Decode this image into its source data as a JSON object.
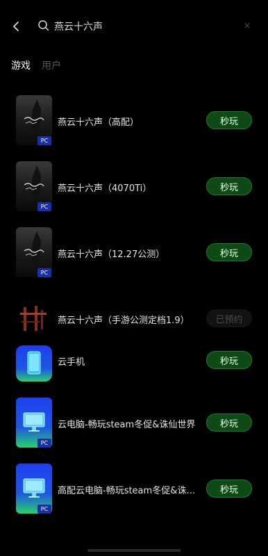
{
  "search": {
    "query": "燕云十六声",
    "clear_symbol": "×"
  },
  "tabs": [
    {
      "label": "游戏",
      "active": true
    },
    {
      "label": "用户",
      "active": false
    }
  ],
  "results": [
    {
      "title": "燕云十六声（高配）",
      "badge": "PC",
      "action": "秒玩",
      "thumb": "yanyun-art"
    },
    {
      "title": "燕云十六声（4070Ti）",
      "badge": "PC",
      "action": "秒玩",
      "thumb": "yanyun-art"
    },
    {
      "title": "燕云十六声（12.27公测）",
      "badge": "PC",
      "action": "秒玩",
      "thumb": "yanyun-art"
    },
    {
      "title": "燕云十六声（手游公测定档1.9）",
      "badge": "",
      "action": "已预约",
      "thumb": "yanyun-logo"
    },
    {
      "title": "云手机",
      "badge": "",
      "action": "秒玩",
      "thumb": "cloud-phone-icon"
    },
    {
      "title": "云电脑-畅玩steam冬促&诛仙世界",
      "badge": "PC",
      "action": "秒玩",
      "thumb": "cloud-pc-icon"
    },
    {
      "title": "高配云电脑-畅玩steam冬促&诛…",
      "badge": "PC",
      "action": "秒玩",
      "thumb": "cloud-pc-icon"
    }
  ],
  "colors": {
    "background": "#000000",
    "play_button": "#0e4a16",
    "play_button_border": "#1d7a2a",
    "pc_badge": "#1a2fa8"
  }
}
